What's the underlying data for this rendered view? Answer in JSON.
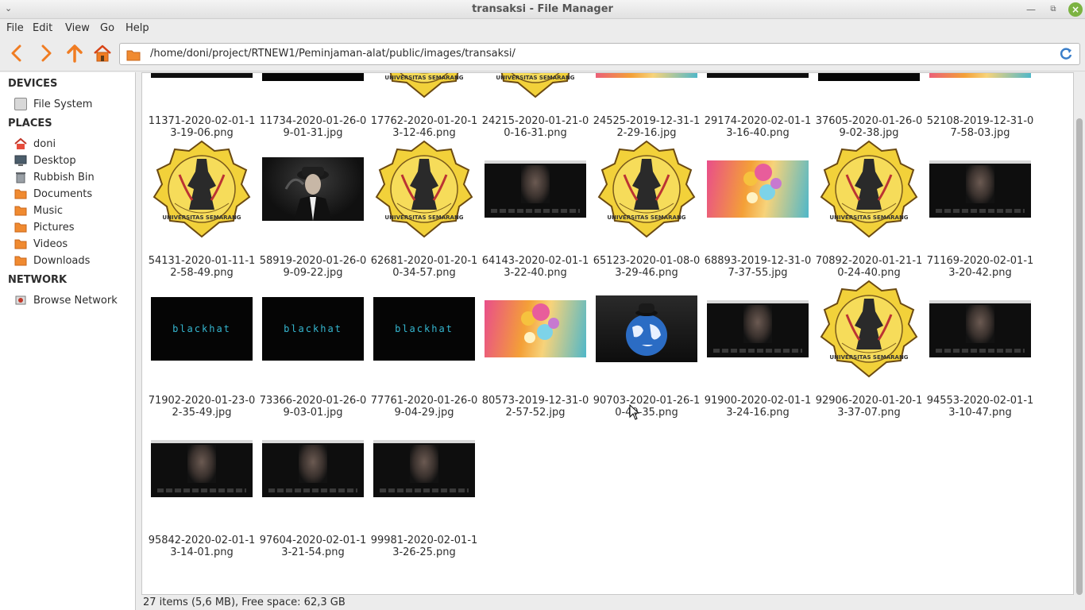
{
  "window": {
    "title": "transaksi - File Manager"
  },
  "menubar": [
    "File",
    "Edit",
    "View",
    "Go",
    "Help"
  ],
  "toolbar": {
    "path": "/home/doni/project/RTNEW1/Peminjaman-alat/public/images/transaksi/"
  },
  "sidebar": {
    "devices_header": "DEVICES",
    "devices": [
      {
        "label": "File System",
        "icon": "drive-icon"
      }
    ],
    "places_header": "PLACES",
    "places": [
      {
        "label": "doni",
        "icon": "home-icon"
      },
      {
        "label": "Desktop",
        "icon": "desktop-icon"
      },
      {
        "label": "Rubbish Bin",
        "icon": "trash-icon"
      },
      {
        "label": "Documents",
        "icon": "folder-icon"
      },
      {
        "label": "Music",
        "icon": "folder-icon"
      },
      {
        "label": "Pictures",
        "icon": "folder-icon"
      },
      {
        "label": "Videos",
        "icon": "folder-icon"
      },
      {
        "label": "Downloads",
        "icon": "folder-icon"
      }
    ],
    "network_header": "NETWORK",
    "network": [
      {
        "label": "Browse Network",
        "icon": "network-icon"
      }
    ]
  },
  "files": [
    {
      "name": "11371-2020-02-01-13-19-06.png",
      "thumb": "screen"
    },
    {
      "name": "11734-2020-01-26-09-01-31.jpg",
      "thumb": "blackhat"
    },
    {
      "name": "17762-2020-01-20-13-12-46.png",
      "thumb": "logo"
    },
    {
      "name": "24215-2020-01-21-00-16-31.png",
      "thumb": "logo"
    },
    {
      "name": "24525-2019-12-31-12-29-16.jpg",
      "thumb": "colorful"
    },
    {
      "name": "29174-2020-02-01-13-16-40.png",
      "thumb": "screen"
    },
    {
      "name": "37605-2020-01-26-09-02-38.jpg",
      "thumb": "blackhat"
    },
    {
      "name": "52108-2019-12-31-07-58-03.jpg",
      "thumb": "colorful"
    },
    {
      "name": "54131-2020-01-11-12-58-49.png",
      "thumb": "logo"
    },
    {
      "name": "58919-2020-01-26-09-09-22.jpg",
      "thumb": "smoke"
    },
    {
      "name": "62681-2020-01-20-10-34-57.png",
      "thumb": "logo"
    },
    {
      "name": "64143-2020-02-01-13-22-40.png",
      "thumb": "screen"
    },
    {
      "name": "65123-2020-01-08-03-29-46.png",
      "thumb": "logo"
    },
    {
      "name": "68893-2019-12-31-07-37-55.jpg",
      "thumb": "colorful"
    },
    {
      "name": "70892-2020-01-21-10-24-40.png",
      "thumb": "logo"
    },
    {
      "name": "71169-2020-02-01-13-20-42.png",
      "thumb": "screen"
    },
    {
      "name": "71902-2020-01-23-02-35-49.jpg",
      "thumb": "blackhat"
    },
    {
      "name": "73366-2020-01-26-09-03-01.jpg",
      "thumb": "blackhat"
    },
    {
      "name": "77761-2020-01-26-09-04-29.jpg",
      "thumb": "blackhat"
    },
    {
      "name": "80573-2019-12-31-02-57-52.jpg",
      "thumb": "colorful"
    },
    {
      "name": "90703-2020-01-26-10-49-35.png",
      "thumb": "globe"
    },
    {
      "name": "91900-2020-02-01-13-24-16.png",
      "thumb": "screen"
    },
    {
      "name": "92906-2020-01-20-13-37-07.png",
      "thumb": "logo"
    },
    {
      "name": "94553-2020-02-01-13-10-47.png",
      "thumb": "screen"
    },
    {
      "name": "95842-2020-02-01-13-14-01.png",
      "thumb": "screen"
    },
    {
      "name": "97604-2020-02-01-13-21-54.png",
      "thumb": "screen"
    },
    {
      "name": "99981-2020-02-01-13-26-25.png",
      "thumb": "screen"
    }
  ],
  "thumb_text": {
    "blackhat": "blackhat",
    "logo": "UNIVERSITAS SEMARANG"
  },
  "statusbar": {
    "text": "27 items (5,6 MB), Free space: 62,3 GB"
  },
  "colors": {
    "accent_orange": "#f07c22",
    "close_green": "#7cb342",
    "reload_blue": "#3a7ec9"
  }
}
